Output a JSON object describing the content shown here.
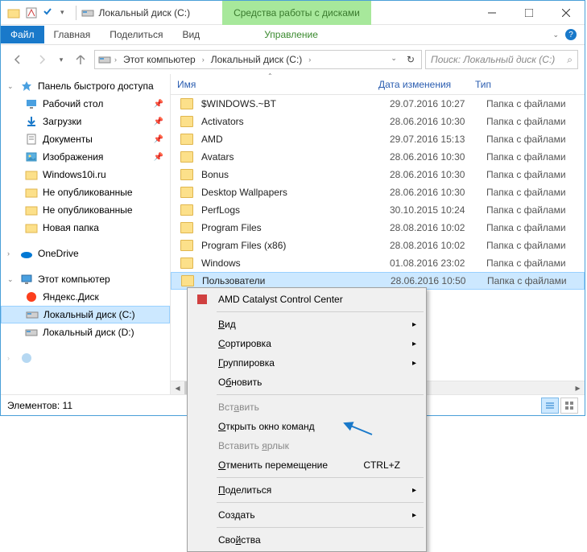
{
  "title": "Локальный диск (C:)",
  "tool_tab": "Средства работы с дисками",
  "ribbon": {
    "file": "Файл",
    "home": "Главная",
    "share": "Поделиться",
    "view": "Вид",
    "manage": "Управление"
  },
  "breadcrumb": [
    "Этот компьютер",
    "Локальный диск (C:)"
  ],
  "search": {
    "placeholder": "Поиск: Локальный диск (C:)"
  },
  "columns": {
    "name": "Имя",
    "date": "Дата изменения",
    "type": "Тип"
  },
  "nav": {
    "quick_access": "Панель быстрого доступа",
    "qa_items": [
      {
        "label": "Рабочий стол",
        "icon": "desktop"
      },
      {
        "label": "Загрузки",
        "icon": "downloads"
      },
      {
        "label": "Документы",
        "icon": "documents"
      },
      {
        "label": "Изображения",
        "icon": "pictures"
      },
      {
        "label": "Windows10i.ru",
        "icon": "folder"
      },
      {
        "label": "Не опубликованные",
        "icon": "folder"
      },
      {
        "label": "Не опубликованные",
        "icon": "folder"
      },
      {
        "label": "Новая папка",
        "icon": "folder"
      }
    ],
    "onedrive": "OneDrive",
    "this_pc": "Этот компьютер",
    "drives": [
      {
        "label": "Яндекс.Диск",
        "icon": "ydisk"
      },
      {
        "label": "Локальный диск (C:)",
        "icon": "drive",
        "selected": true
      },
      {
        "label": "Локальный диск (D:)",
        "icon": "drive"
      }
    ]
  },
  "files": [
    {
      "name": "$WINDOWS.~BT",
      "date": "29.07.2016 10:27",
      "type": "Папка с файлами"
    },
    {
      "name": "Activators",
      "date": "28.06.2016 10:30",
      "type": "Папка с файлами"
    },
    {
      "name": "AMD",
      "date": "29.07.2016 15:13",
      "type": "Папка с файлами"
    },
    {
      "name": "Avatars",
      "date": "28.06.2016 10:30",
      "type": "Папка с файлами"
    },
    {
      "name": "Bonus",
      "date": "28.06.2016 10:30",
      "type": "Папка с файлами"
    },
    {
      "name": "Desktop Wallpapers",
      "date": "28.06.2016 10:30",
      "type": "Папка с файлами"
    },
    {
      "name": "PerfLogs",
      "date": "30.10.2015 10:24",
      "type": "Папка с файлами"
    },
    {
      "name": "Program Files",
      "date": "28.08.2016 10:02",
      "type": "Папка с файлами"
    },
    {
      "name": "Program Files (x86)",
      "date": "28.08.2016 10:02",
      "type": "Папка с файлами"
    },
    {
      "name": "Windows",
      "date": "01.08.2016 23:02",
      "type": "Папка с файлами"
    },
    {
      "name": "Пользователи",
      "date": "28.06.2016 10:50",
      "type": "Папка с файлами",
      "selected": true
    }
  ],
  "status": "Элементов: 11",
  "context_menu": {
    "amd": "AMD Catalyst Control Center",
    "view": "Вид",
    "sort": "Сортировка",
    "group": "Группировка",
    "refresh": "Обновить",
    "paste": "Вставить",
    "open_cmd": "Открыть окно команд",
    "paste_shortcut": "Вставить ярлык",
    "undo": "Отменить перемещение",
    "undo_key": "CTRL+Z",
    "share": "Поделиться",
    "new": "Создать",
    "properties": "Свойства"
  }
}
